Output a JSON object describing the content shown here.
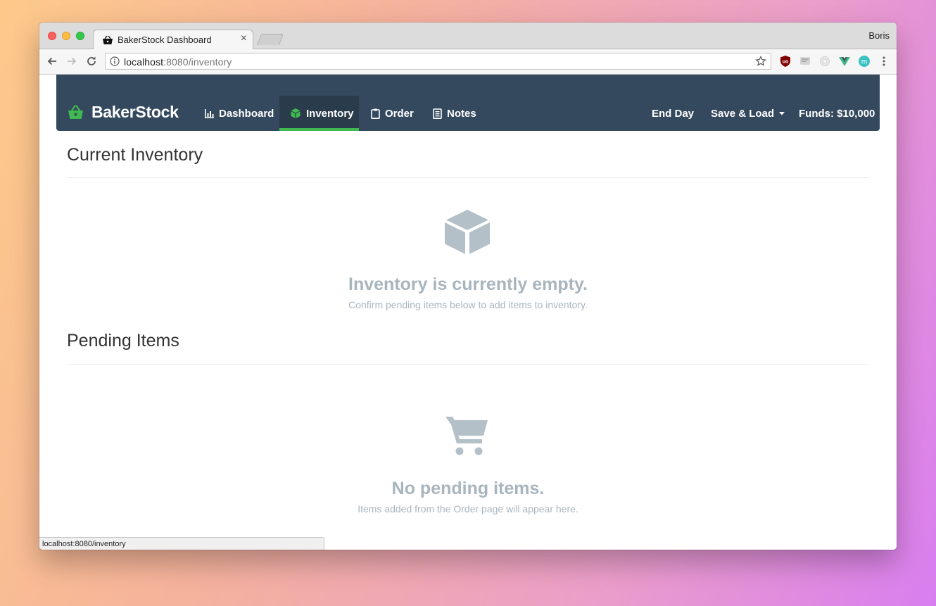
{
  "browser": {
    "tab_title": "BakerStock Dashboard",
    "tab_close": "×",
    "profile_name": "Boris",
    "url_host": "localhost",
    "url_rest": ":8080/inventory",
    "status_url": "localhost:8080/inventory"
  },
  "navbar": {
    "brand": "BakerStock",
    "items": [
      {
        "label": "Dashboard",
        "icon": "bar-chart-icon",
        "active": false
      },
      {
        "label": "Inventory",
        "icon": "cube-icon",
        "active": true
      },
      {
        "label": "Order",
        "icon": "clipboard-icon",
        "active": false
      },
      {
        "label": "Notes",
        "icon": "notepad-icon",
        "active": false
      }
    ],
    "end_day": "End Day",
    "save_load": "Save & Load",
    "funds": "Funds: $10,000"
  },
  "inventory": {
    "heading": "Current Inventory",
    "empty_title": "Inventory is currently empty.",
    "empty_sub": "Confirm pending items below to add items to inventory.",
    "icon": "cube-icon"
  },
  "pending": {
    "heading": "Pending Items",
    "empty_title": "No pending items.",
    "empty_sub": "Items added from the Order page will appear here.",
    "icon": "shopping-cart-icon"
  },
  "colors": {
    "navbar_bg": "#34495e",
    "accent_green": "#3fb950",
    "muted": "#a8b5be",
    "icon_muted": "#b4c0c8"
  }
}
